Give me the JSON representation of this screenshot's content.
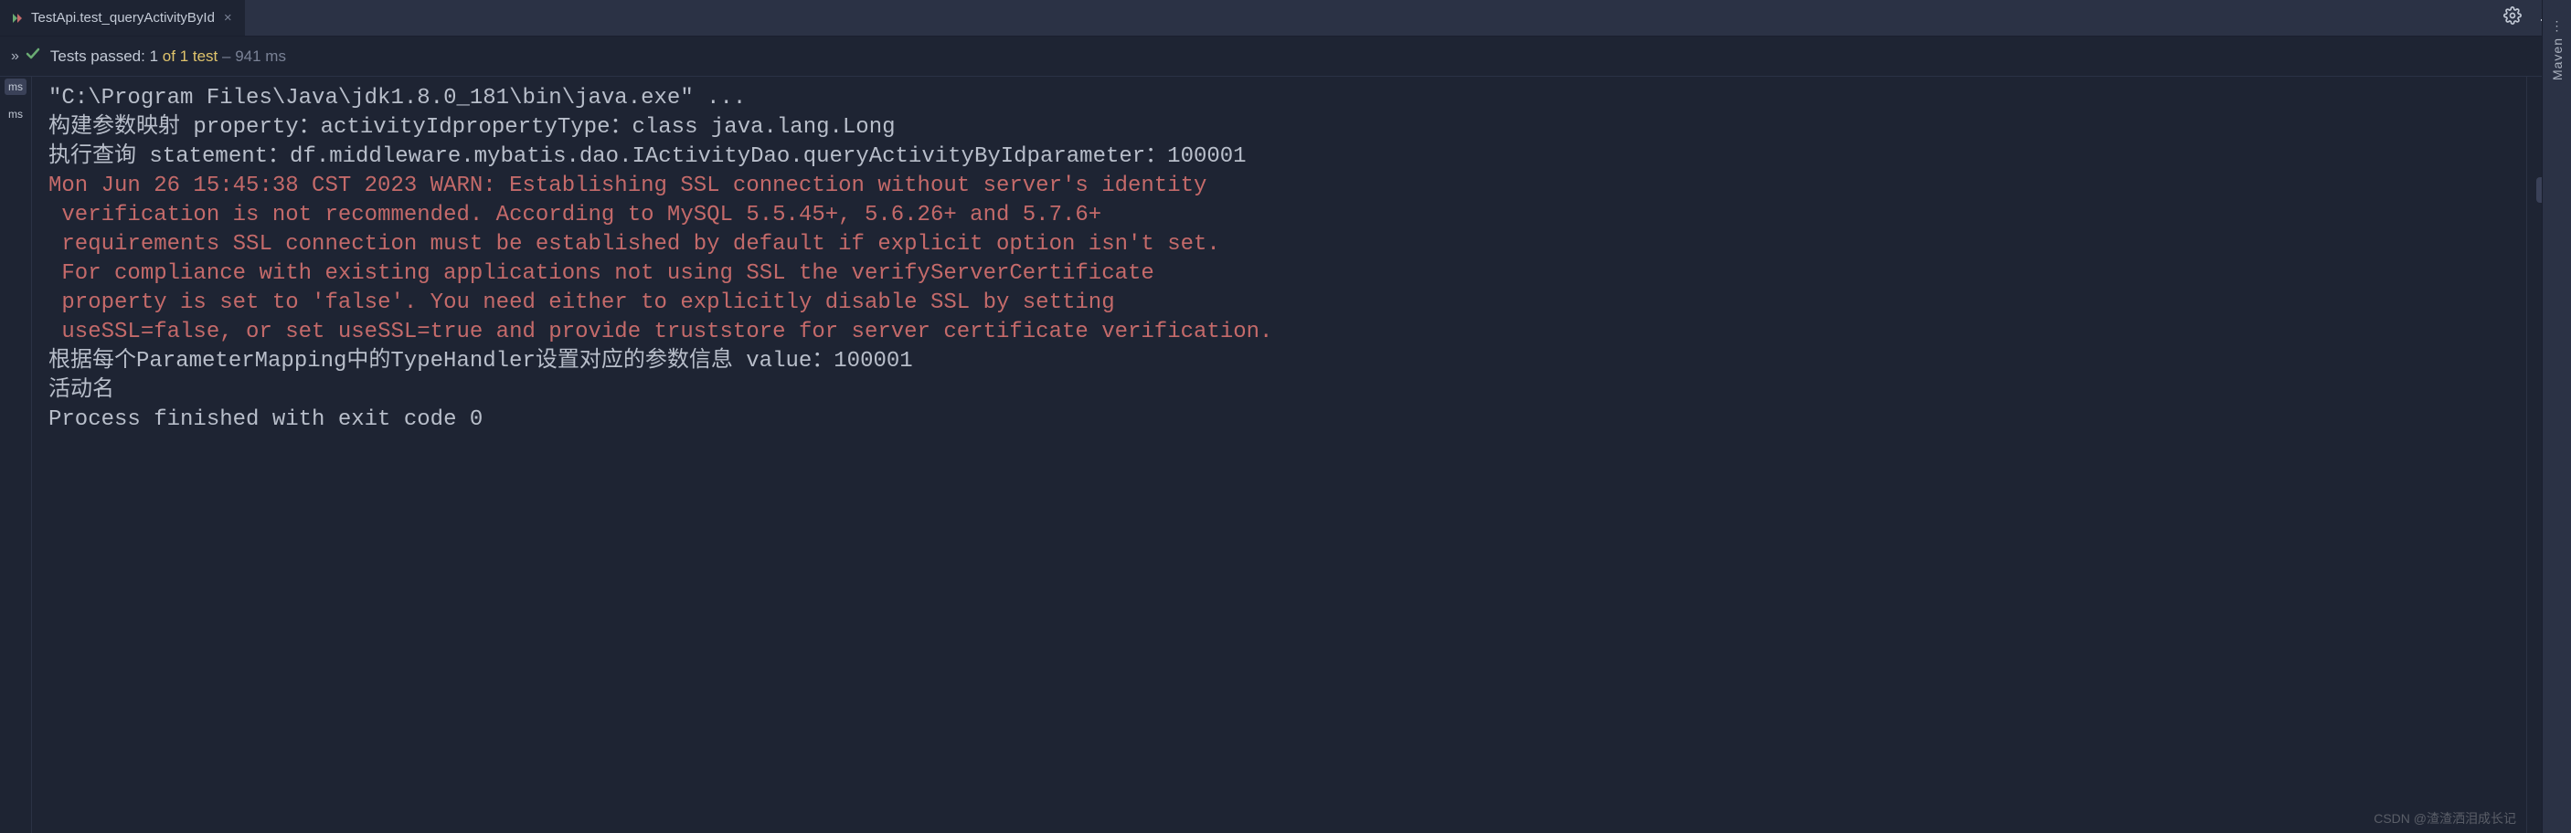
{
  "tab": {
    "label": "TestApi.test_queryActivityById",
    "close_glyph": "×"
  },
  "status": {
    "passed_prefix": "Tests passed:",
    "passed_count": "1",
    "of_text": "of 1 test",
    "dash": "–",
    "duration": "941 ms"
  },
  "gutter": {
    "label1": "ms",
    "label2": "ms"
  },
  "console": {
    "line1": "\"C:\\Program Files\\Java\\jdk1.8.0_181\\bin\\java.exe\" ...",
    "line2": "构建参数映射 property：activityIdpropertyType：class java.lang.Long",
    "line3": "执行查询 statement：df.middleware.mybatis.dao.IActivityDao.queryActivityByIdparameter：100001",
    "line4": "Mon Jun 26 15:45:38 CST 2023 WARN: Establishing SSL connection without server's identity",
    "line5": " verification is not recommended. According to MySQL 5.5.45+, 5.6.26+ and 5.7.6+ ",
    "line6": " requirements SSL connection must be established by default if explicit option isn't set. ",
    "line7": " For compliance with existing applications not using SSL the verifyServerCertificate ",
    "line8": " property is set to 'false'. You need either to explicitly disable SSL by setting ",
    "line9": " useSSL=false, or set useSSL=true and provide truststore for server certificate verification.",
    "line10": "根据每个ParameterMapping中的TypeHandler设置对应的参数信息 value：100001",
    "line11": "活动名",
    "line12": "",
    "line13": "Process finished with exit code 0"
  },
  "sidebar": {
    "maven": "Maven"
  },
  "watermark": "CSDN @渣渣洒泪成长记"
}
